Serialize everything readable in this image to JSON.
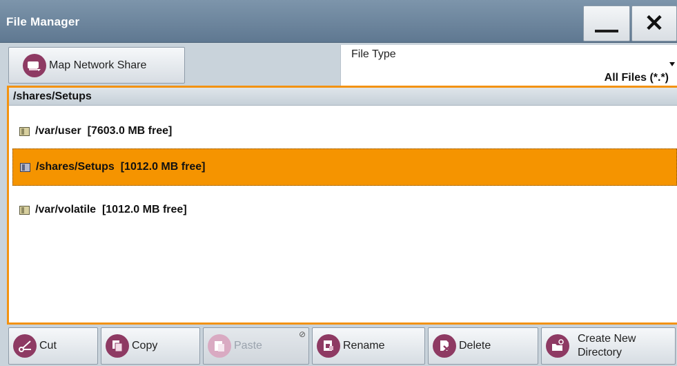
{
  "window": {
    "title": "File Manager",
    "minimize_icon": "minimize-icon",
    "close_icon": "close-icon",
    "close_glyph": "✕"
  },
  "toolbar": {
    "map_network_share_label": "Map Network Share",
    "map_network_share_icon": "network-share-icon"
  },
  "file_type": {
    "label": "File Type",
    "selected": "All Files (*.*)"
  },
  "current_path": "/shares/Setups",
  "directories": [
    {
      "path": "/var/user",
      "free": "[7603.0 MB free]",
      "selected": false
    },
    {
      "path": "/shares/Setups",
      "free": "[1012.0 MB free]",
      "selected": true
    },
    {
      "path": "/var/volatile",
      "free": "[1012.0 MB free]",
      "selected": false
    }
  ],
  "actions": {
    "cut": "Cut",
    "copy": "Copy",
    "paste": "Paste",
    "paste_disabled_marker": "⊘",
    "rename": "Rename",
    "delete": "Delete",
    "create_new_directory_line1": "Create New",
    "create_new_directory_line2": "Directory"
  },
  "colors": {
    "accent_orange": "#f59400",
    "icon_purple": "#8e3a63",
    "titlebar": "#6a8399"
  }
}
